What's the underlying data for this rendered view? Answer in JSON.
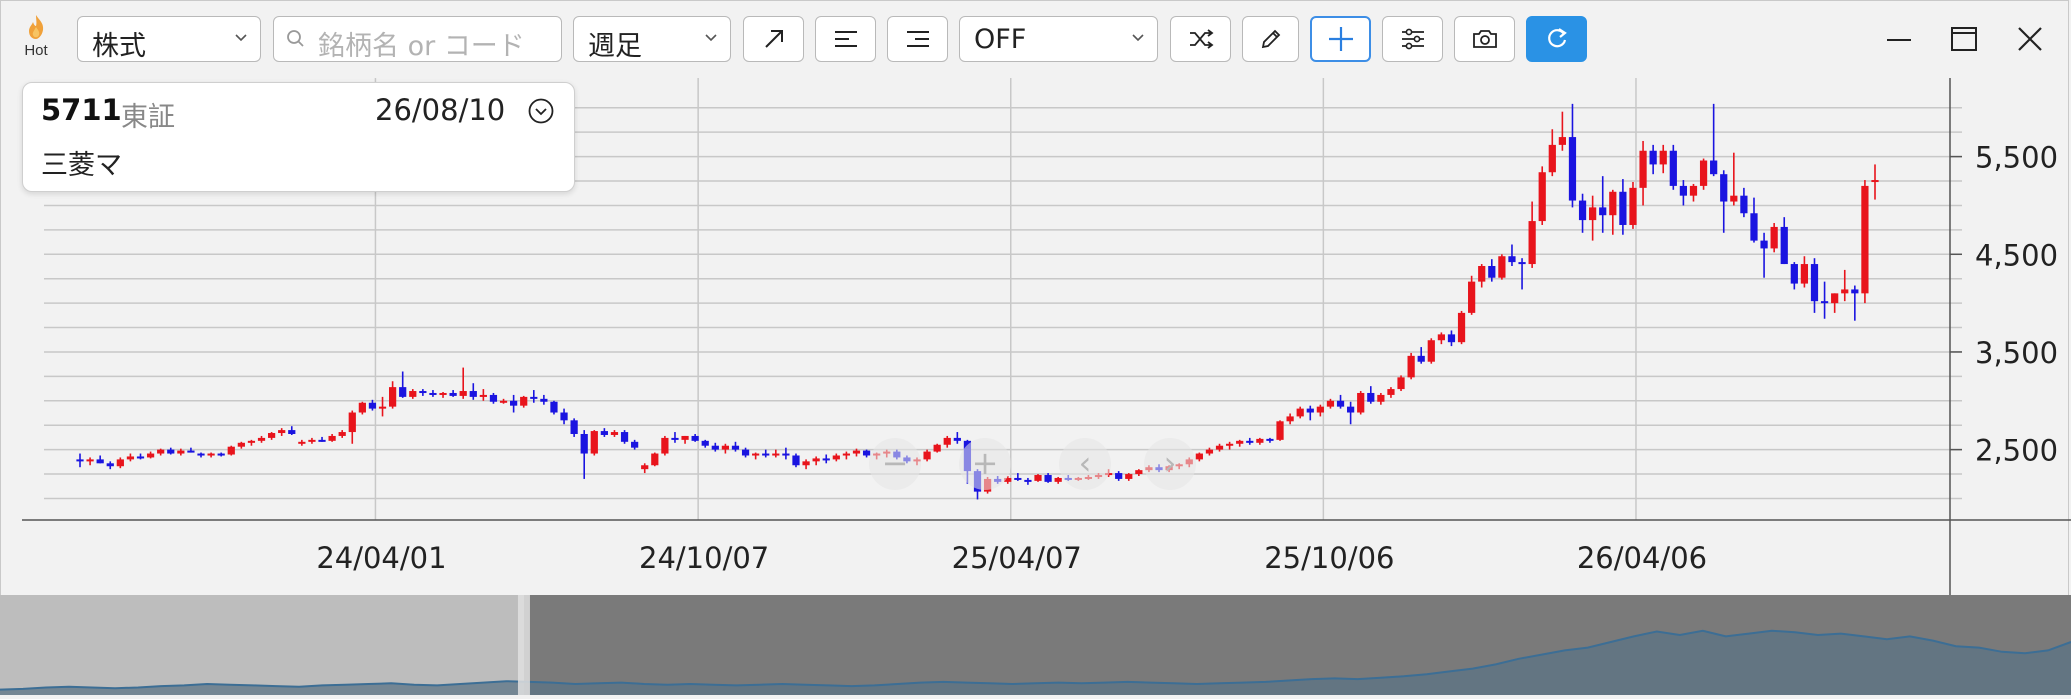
{
  "toolbar": {
    "hot_label": "Hot",
    "market_select": "株式",
    "search_placeholder": "銘柄名 or コード",
    "period_select": "週足",
    "indicator_select": "OFF",
    "buttons": [
      "trend-line",
      "align-left",
      "align-right",
      "shuffle",
      "pencil",
      "crosshair",
      "settings",
      "camera",
      "refresh"
    ]
  },
  "card": {
    "code": "5711",
    "market": "東証",
    "date": "26/08/10",
    "name": "三菱マ"
  },
  "colors": {
    "up": "#e8141c",
    "down": "#1a14e0",
    "accent": "#2a92e5",
    "grid": "#c8c8c8"
  },
  "chart_data": {
    "type": "candlestick",
    "yticks": [
      "5,500",
      "4,500",
      "3,500",
      "2,500"
    ],
    "xticks": [
      "24/04/01",
      "24/10/07",
      "25/04/07",
      "25/10/06",
      "26/04/06"
    ],
    "ylim": [
      1800,
      6100
    ],
    "ohlc": [
      [
        2400,
        2460,
        2320,
        2380
      ],
      [
        2380,
        2420,
        2340,
        2400
      ],
      [
        2400,
        2440,
        2360,
        2360
      ],
      [
        2360,
        2380,
        2300,
        2330
      ],
      [
        2330,
        2420,
        2310,
        2400
      ],
      [
        2400,
        2460,
        2380,
        2430
      ],
      [
        2430,
        2460,
        2400,
        2420
      ],
      [
        2420,
        2480,
        2410,
        2460
      ],
      [
        2460,
        2510,
        2440,
        2500
      ],
      [
        2500,
        2520,
        2450,
        2460
      ],
      [
        2460,
        2510,
        2440,
        2490
      ],
      [
        2490,
        2520,
        2470,
        2480
      ],
      [
        2460,
        2470,
        2420,
        2440
      ],
      [
        2440,
        2470,
        2420,
        2460
      ],
      [
        2460,
        2470,
        2430,
        2450
      ],
      [
        2450,
        2540,
        2440,
        2530
      ],
      [
        2530,
        2580,
        2510,
        2570
      ],
      [
        2570,
        2600,
        2540,
        2590
      ],
      [
        2590,
        2640,
        2570,
        2620
      ],
      [
        2620,
        2680,
        2600,
        2670
      ],
      [
        2670,
        2720,
        2640,
        2700
      ],
      [
        2700,
        2740,
        2650,
        2660
      ],
      [
        2580,
        2600,
        2540,
        2580
      ],
      [
        2580,
        2620,
        2560,
        2600
      ],
      [
        2600,
        2630,
        2580,
        2590
      ],
      [
        2590,
        2660,
        2580,
        2640
      ],
      [
        2640,
        2700,
        2620,
        2680
      ],
      [
        2680,
        2900,
        2560,
        2880
      ],
      [
        2880,
        2990,
        2860,
        2980
      ],
      [
        2980,
        3010,
        2900,
        2920
      ],
      [
        2920,
        3040,
        2840,
        2940
      ],
      [
        2940,
        3200,
        2920,
        3140
      ],
      [
        3140,
        3300,
        3030,
        3040
      ],
      [
        3040,
        3120,
        3020,
        3100
      ],
      [
        3100,
        3120,
        3050,
        3080
      ],
      [
        3080,
        3110,
        3040,
        3060
      ],
      [
        3060,
        3090,
        3030,
        3080
      ],
      [
        3080,
        3110,
        3040,
        3050
      ],
      [
        3050,
        3340,
        3020,
        3100
      ],
      [
        3100,
        3180,
        3010,
        3040
      ],
      [
        3040,
        3120,
        3000,
        3060
      ],
      [
        3060,
        3080,
        2970,
        2990
      ],
      [
        2990,
        3020,
        2970,
        3000
      ],
      [
        3000,
        3060,
        2880,
        2950
      ],
      [
        2950,
        3050,
        2930,
        3040
      ],
      [
        3040,
        3110,
        2980,
        3020
      ],
      [
        3020,
        3060,
        2960,
        2990
      ],
      [
        2990,
        3000,
        2860,
        2880
      ],
      [
        2880,
        2920,
        2760,
        2800
      ],
      [
        2800,
        2820,
        2630,
        2660
      ],
      [
        2660,
        2700,
        2200,
        2460
      ],
      [
        2460,
        2700,
        2440,
        2690
      ],
      [
        2690,
        2720,
        2630,
        2650
      ],
      [
        2650,
        2700,
        2630,
        2680
      ],
      [
        2680,
        2700,
        2560,
        2580
      ],
      [
        2580,
        2600,
        2500,
        2520
      ],
      [
        2300,
        2360,
        2260,
        2340
      ],
      [
        2340,
        2470,
        2330,
        2460
      ],
      [
        2460,
        2640,
        2440,
        2620
      ],
      [
        2620,
        2680,
        2570,
        2600
      ],
      [
        2600,
        2640,
        2560,
        2640
      ],
      [
        2640,
        2660,
        2580,
        2590
      ],
      [
        2590,
        2600,
        2520,
        2540
      ],
      [
        2540,
        2570,
        2480,
        2500
      ],
      [
        2500,
        2560,
        2460,
        2540
      ],
      [
        2540,
        2580,
        2480,
        2500
      ],
      [
        2500,
        2520,
        2420,
        2440
      ],
      [
        2440,
        2470,
        2400,
        2460
      ],
      [
        2460,
        2500,
        2420,
        2440
      ],
      [
        2440,
        2500,
        2420,
        2460
      ],
      [
        2460,
        2520,
        2400,
        2440
      ],
      [
        2440,
        2460,
        2320,
        2340
      ],
      [
        2340,
        2400,
        2300,
        2380
      ],
      [
        2380,
        2430,
        2340,
        2410
      ],
      [
        2410,
        2450,
        2360,
        2400
      ],
      [
        2400,
        2460,
        2380,
        2440
      ],
      [
        2440,
        2480,
        2400,
        2460
      ],
      [
        2460,
        2510,
        2430,
        2490
      ],
      [
        2490,
        2500,
        2420,
        2440
      ],
      [
        2440,
        2470,
        2400,
        2460
      ],
      [
        2460,
        2500,
        2420,
        2480
      ],
      [
        2480,
        2500,
        2400,
        2420
      ],
      [
        2420,
        2440,
        2360,
        2380
      ],
      [
        2380,
        2420,
        2340,
        2400
      ],
      [
        2400,
        2500,
        2380,
        2480
      ],
      [
        2480,
        2560,
        2470,
        2550
      ],
      [
        2550,
        2640,
        2520,
        2620
      ],
      [
        2620,
        2680,
        2560,
        2590
      ],
      [
        2590,
        2600,
        2150,
        2280
      ],
      [
        2280,
        2300,
        1990,
        2070
      ],
      [
        2070,
        2220,
        2050,
        2200
      ],
      [
        2200,
        2230,
        2150,
        2170
      ],
      [
        2170,
        2230,
        2150,
        2210
      ],
      [
        2210,
        2260,
        2180,
        2190
      ],
      [
        2190,
        2210,
        2140,
        2180
      ],
      [
        2180,
        2250,
        2170,
        2240
      ],
      [
        2240,
        2260,
        2160,
        2170
      ],
      [
        2170,
        2220,
        2150,
        2210
      ],
      [
        2210,
        2240,
        2180,
        2200
      ],
      [
        2200,
        2220,
        2180,
        2210
      ],
      [
        2210,
        2240,
        2190,
        2220
      ],
      [
        2220,
        2260,
        2200,
        2240
      ],
      [
        2240,
        2300,
        2220,
        2260
      ],
      [
        2260,
        2280,
        2180,
        2200
      ],
      [
        2200,
        2260,
        2180,
        2250
      ],
      [
        2250,
        2300,
        2230,
        2290
      ],
      [
        2290,
        2340,
        2270,
        2320
      ],
      [
        2320,
        2350,
        2270,
        2290
      ],
      [
        2290,
        2340,
        2270,
        2330
      ],
      [
        2330,
        2360,
        2300,
        2350
      ],
      [
        2350,
        2420,
        2320,
        2400
      ],
      [
        2400,
        2470,
        2380,
        2460
      ],
      [
        2460,
        2520,
        2440,
        2500
      ],
      [
        2500,
        2560,
        2480,
        2540
      ],
      [
        2540,
        2580,
        2500,
        2560
      ],
      [
        2560,
        2600,
        2530,
        2590
      ],
      [
        2590,
        2620,
        2550,
        2570
      ],
      [
        2570,
        2620,
        2550,
        2610
      ],
      [
        2610,
        2620,
        2570,
        2600
      ],
      [
        2600,
        2800,
        2590,
        2790
      ],
      [
        2790,
        2870,
        2760,
        2840
      ],
      [
        2840,
        2940,
        2820,
        2920
      ],
      [
        2920,
        2950,
        2800,
        2880
      ],
      [
        2880,
        2960,
        2840,
        2940
      ],
      [
        2940,
        3020,
        2920,
        3000
      ],
      [
        3000,
        3060,
        2920,
        2940
      ],
      [
        2940,
        2990,
        2760,
        2880
      ],
      [
        2880,
        3100,
        2860,
        3080
      ],
      [
        3080,
        3150,
        2970,
        2990
      ],
      [
        2990,
        3080,
        2960,
        3060
      ],
      [
        3060,
        3140,
        3030,
        3120
      ],
      [
        3120,
        3260,
        3100,
        3240
      ],
      [
        3240,
        3490,
        3220,
        3460
      ],
      [
        3460,
        3550,
        3380,
        3400
      ],
      [
        3400,
        3640,
        3380,
        3620
      ],
      [
        3620,
        3700,
        3580,
        3680
      ],
      [
        3680,
        3720,
        3560,
        3600
      ],
      [
        3600,
        3920,
        3580,
        3900
      ],
      [
        3900,
        4280,
        3880,
        4220
      ],
      [
        4220,
        4400,
        4160,
        4380
      ],
      [
        4380,
        4450,
        4220,
        4260
      ],
      [
        4260,
        4500,
        4240,
        4480
      ],
      [
        4480,
        4600,
        4380,
        4420
      ],
      [
        4420,
        4460,
        4140,
        4400
      ],
      [
        4400,
        5040,
        4360,
        4840
      ],
      [
        4840,
        5400,
        4800,
        5340
      ],
      [
        5340,
        5780,
        5300,
        5620
      ],
      [
        5620,
        5960,
        5560,
        5700
      ],
      [
        5700,
        6040,
        4980,
        5050
      ],
      [
        5050,
        5120,
        4720,
        4850
      ],
      [
        4850,
        5100,
        4640,
        4980
      ],
      [
        4980,
        5300,
        4720,
        4900
      ],
      [
        4900,
        5160,
        4700,
        5140
      ],
      [
        5140,
        5270,
        4700,
        4800
      ],
      [
        4800,
        5240,
        4760,
        5180
      ],
      [
        5180,
        5660,
        5000,
        5560
      ],
      [
        5560,
        5620,
        5320,
        5420
      ],
      [
        5420,
        5620,
        5330,
        5560
      ],
      [
        5560,
        5620,
        5160,
        5200
      ],
      [
        5200,
        5260,
        5000,
        5100
      ],
      [
        5100,
        5220,
        5040,
        5200
      ],
      [
        5200,
        5480,
        5160,
        5460
      ],
      [
        5460,
        6040,
        5300,
        5320
      ],
      [
        5320,
        5360,
        4720,
        5040
      ],
      [
        5040,
        5540,
        5000,
        5100
      ],
      [
        5100,
        5180,
        4880,
        4920
      ],
      [
        4920,
        5080,
        4620,
        4640
      ],
      [
        4640,
        4720,
        4260,
        4560
      ],
      [
        4560,
        4820,
        4520,
        4780
      ],
      [
        4780,
        4880,
        4400,
        4400
      ],
      [
        4400,
        4420,
        4140,
        4200
      ],
      [
        4200,
        4480,
        4160,
        4400
      ],
      [
        4400,
        4460,
        3900,
        4020
      ],
      [
        4020,
        4220,
        3840,
        4000
      ],
      [
        4000,
        4100,
        3900,
        4100
      ],
      [
        4100,
        4340,
        4020,
        4140
      ],
      [
        4140,
        4180,
        3820,
        4100
      ],
      [
        4100,
        5260,
        4000,
        5200
      ],
      [
        5240,
        5420,
        5060,
        5260
      ]
    ]
  },
  "navigator": {
    "series": [
      0.02,
      0.03,
      0.05,
      0.06,
      0.05,
      0.04,
      0.05,
      0.07,
      0.08,
      0.1,
      0.09,
      0.08,
      0.07,
      0.06,
      0.08,
      0.09,
      0.1,
      0.11,
      0.09,
      0.08,
      0.1,
      0.12,
      0.14,
      0.13,
      0.12,
      0.1,
      0.11,
      0.12,
      0.1,
      0.09,
      0.1,
      0.09,
      0.08,
      0.09,
      0.1,
      0.09,
      0.08,
      0.07,
      0.08,
      0.1,
      0.12,
      0.13,
      0.12,
      0.11,
      0.1,
      0.11,
      0.12,
      0.11,
      0.12,
      0.13,
      0.12,
      0.11,
      0.1,
      0.11,
      0.12,
      0.13,
      0.15,
      0.17,
      0.18,
      0.17,
      0.19,
      0.21,
      0.24,
      0.28,
      0.32,
      0.38,
      0.46,
      0.52,
      0.58,
      0.62,
      0.7,
      0.78,
      0.85,
      0.8,
      0.86,
      0.78,
      0.82,
      0.86,
      0.84,
      0.8,
      0.82,
      0.78,
      0.74,
      0.78,
      0.72,
      0.64,
      0.62,
      0.56,
      0.54,
      0.58,
      0.7
    ],
    "window_start": 0.253
  }
}
